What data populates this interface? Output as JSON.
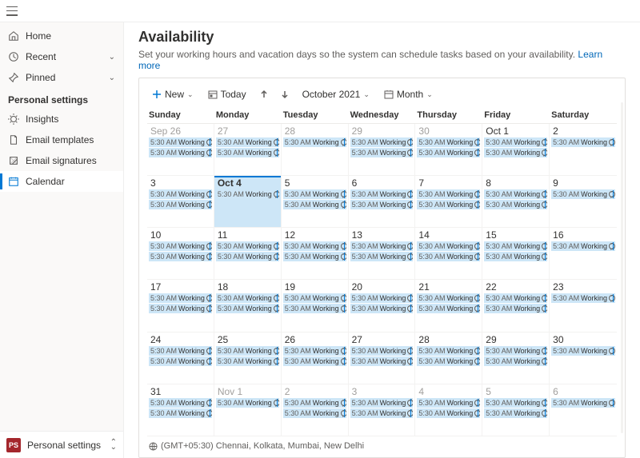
{
  "nav": {
    "home": "Home",
    "recent": "Recent",
    "pinned": "Pinned",
    "header": "Personal settings",
    "insights": "Insights",
    "emailTemplates": "Email templates",
    "emailSignatures": "Email signatures",
    "calendar": "Calendar"
  },
  "footer": {
    "badge": "PS",
    "label": "Personal settings"
  },
  "page": {
    "title": "Availability",
    "subtitle": "Set your working hours and vacation days so the system can schedule tasks based on your availability.",
    "learnMore": "Learn more"
  },
  "toolbar": {
    "new": "New",
    "today": "Today",
    "period": "October 2021",
    "view": "Month"
  },
  "dayHeaders": [
    "Sunday",
    "Monday",
    "Tuesday",
    "Wednesday",
    "Thursday",
    "Friday",
    "Saturday"
  ],
  "eventTime": "5:30 AM",
  "eventLabel": "Working",
  "weeks": [
    [
      {
        "n": "Sep 26",
        "o": true,
        "e": 2
      },
      {
        "n": "27",
        "o": true,
        "e": 2
      },
      {
        "n": "28",
        "o": true,
        "e": 1
      },
      {
        "n": "29",
        "o": true,
        "e": 2
      },
      {
        "n": "30",
        "o": true,
        "e": 2
      },
      {
        "n": "Oct 1",
        "e": 2
      },
      {
        "n": "2",
        "e": 1
      }
    ],
    [
      {
        "n": "3",
        "e": 2
      },
      {
        "n": "Oct 4",
        "t": true,
        "e": 1
      },
      {
        "n": "5",
        "e": 2
      },
      {
        "n": "6",
        "e": 2
      },
      {
        "n": "7",
        "e": 2
      },
      {
        "n": "8",
        "e": 2
      },
      {
        "n": "9",
        "e": 1
      }
    ],
    [
      {
        "n": "10",
        "e": 2
      },
      {
        "n": "11",
        "e": 2
      },
      {
        "n": "12",
        "e": 2
      },
      {
        "n": "13",
        "e": 2
      },
      {
        "n": "14",
        "e": 2
      },
      {
        "n": "15",
        "e": 2
      },
      {
        "n": "16",
        "e": 1
      }
    ],
    [
      {
        "n": "17",
        "e": 2
      },
      {
        "n": "18",
        "e": 2
      },
      {
        "n": "19",
        "e": 2
      },
      {
        "n": "20",
        "e": 2
      },
      {
        "n": "21",
        "e": 2
      },
      {
        "n": "22",
        "e": 2
      },
      {
        "n": "23",
        "e": 1
      }
    ],
    [
      {
        "n": "24",
        "e": 2
      },
      {
        "n": "25",
        "e": 2
      },
      {
        "n": "26",
        "e": 2
      },
      {
        "n": "27",
        "e": 2
      },
      {
        "n": "28",
        "e": 2
      },
      {
        "n": "29",
        "e": 2
      },
      {
        "n": "30",
        "e": 1
      }
    ],
    [
      {
        "n": "31",
        "e": 2
      },
      {
        "n": "Nov 1",
        "o": true,
        "e": 1
      },
      {
        "n": "2",
        "o": true,
        "e": 2
      },
      {
        "n": "3",
        "o": true,
        "e": 2
      },
      {
        "n": "4",
        "o": true,
        "e": 2
      },
      {
        "n": "5",
        "o": true,
        "e": 2
      },
      {
        "n": "6",
        "o": true,
        "e": 1
      }
    ]
  ],
  "timezone": "(GMT+05:30) Chennai, Kolkata, Mumbai, New Delhi"
}
